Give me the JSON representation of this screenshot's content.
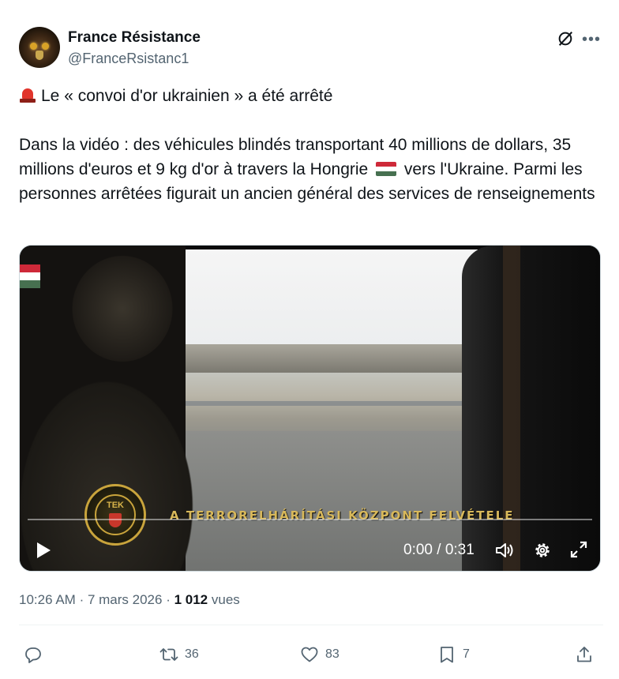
{
  "author": {
    "name": "France Résistance",
    "handle": "@FranceRsistanc1",
    "avatar_icon": "eagle-avatar"
  },
  "header_icons": [
    "grok-icon",
    "more-icon"
  ],
  "tweet": {
    "line1": "Le « convoi d'or ukrainien » a été arrêté",
    "para2_a": "Dans la vidéo : des véhicules blindés transportant 40 millions de dollars, 35 millions d'euros et 9 kg d'or à travers la Hongrie",
    "para2_b": "vers l'Ukraine.",
    "para3": "Parmi les personnes arrêtées figurait un ancien général des services de renseignements"
  },
  "video": {
    "caption": "A TERRORELHÁRÍTÁSI KÖZPONT FELVÉTELE",
    "logo_text": "TEK",
    "time": "0:00 / 0:31",
    "progress": 0.0
  },
  "meta": {
    "time": "10:26 AM",
    "date": "7 mars 2026",
    "views": "1 012",
    "views_label": "vues"
  },
  "actions": {
    "reply": "",
    "retweets": "36",
    "likes": "83",
    "bookmarks": "7"
  },
  "colors": {
    "text": "#0f1419",
    "muted": "#536471",
    "siren": "#e1342b",
    "flag_red": "#ce2939",
    "flag_green": "#477050"
  }
}
